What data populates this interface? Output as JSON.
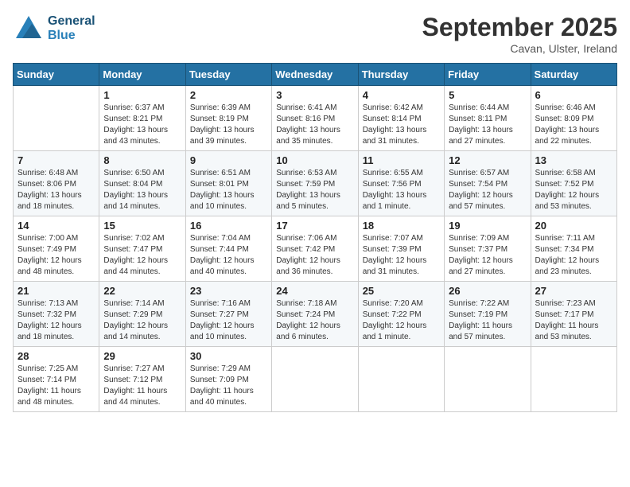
{
  "logo": {
    "general": "General",
    "blue": "Blue"
  },
  "title": "September 2025",
  "subtitle": "Cavan, Ulster, Ireland",
  "days_of_week": [
    "Sunday",
    "Monday",
    "Tuesday",
    "Wednesday",
    "Thursday",
    "Friday",
    "Saturday"
  ],
  "weeks": [
    [
      {
        "day": "",
        "info": ""
      },
      {
        "day": "1",
        "info": "Sunrise: 6:37 AM\nSunset: 8:21 PM\nDaylight: 13 hours\nand 43 minutes."
      },
      {
        "day": "2",
        "info": "Sunrise: 6:39 AM\nSunset: 8:19 PM\nDaylight: 13 hours\nand 39 minutes."
      },
      {
        "day": "3",
        "info": "Sunrise: 6:41 AM\nSunset: 8:16 PM\nDaylight: 13 hours\nand 35 minutes."
      },
      {
        "day": "4",
        "info": "Sunrise: 6:42 AM\nSunset: 8:14 PM\nDaylight: 13 hours\nand 31 minutes."
      },
      {
        "day": "5",
        "info": "Sunrise: 6:44 AM\nSunset: 8:11 PM\nDaylight: 13 hours\nand 27 minutes."
      },
      {
        "day": "6",
        "info": "Sunrise: 6:46 AM\nSunset: 8:09 PM\nDaylight: 13 hours\nand 22 minutes."
      }
    ],
    [
      {
        "day": "7",
        "info": "Sunrise: 6:48 AM\nSunset: 8:06 PM\nDaylight: 13 hours\nand 18 minutes."
      },
      {
        "day": "8",
        "info": "Sunrise: 6:50 AM\nSunset: 8:04 PM\nDaylight: 13 hours\nand 14 minutes."
      },
      {
        "day": "9",
        "info": "Sunrise: 6:51 AM\nSunset: 8:01 PM\nDaylight: 13 hours\nand 10 minutes."
      },
      {
        "day": "10",
        "info": "Sunrise: 6:53 AM\nSunset: 7:59 PM\nDaylight: 13 hours\nand 5 minutes."
      },
      {
        "day": "11",
        "info": "Sunrise: 6:55 AM\nSunset: 7:56 PM\nDaylight: 13 hours\nand 1 minute."
      },
      {
        "day": "12",
        "info": "Sunrise: 6:57 AM\nSunset: 7:54 PM\nDaylight: 12 hours\nand 57 minutes."
      },
      {
        "day": "13",
        "info": "Sunrise: 6:58 AM\nSunset: 7:52 PM\nDaylight: 12 hours\nand 53 minutes."
      }
    ],
    [
      {
        "day": "14",
        "info": "Sunrise: 7:00 AM\nSunset: 7:49 PM\nDaylight: 12 hours\nand 48 minutes."
      },
      {
        "day": "15",
        "info": "Sunrise: 7:02 AM\nSunset: 7:47 PM\nDaylight: 12 hours\nand 44 minutes."
      },
      {
        "day": "16",
        "info": "Sunrise: 7:04 AM\nSunset: 7:44 PM\nDaylight: 12 hours\nand 40 minutes."
      },
      {
        "day": "17",
        "info": "Sunrise: 7:06 AM\nSunset: 7:42 PM\nDaylight: 12 hours\nand 36 minutes."
      },
      {
        "day": "18",
        "info": "Sunrise: 7:07 AM\nSunset: 7:39 PM\nDaylight: 12 hours\nand 31 minutes."
      },
      {
        "day": "19",
        "info": "Sunrise: 7:09 AM\nSunset: 7:37 PM\nDaylight: 12 hours\nand 27 minutes."
      },
      {
        "day": "20",
        "info": "Sunrise: 7:11 AM\nSunset: 7:34 PM\nDaylight: 12 hours\nand 23 minutes."
      }
    ],
    [
      {
        "day": "21",
        "info": "Sunrise: 7:13 AM\nSunset: 7:32 PM\nDaylight: 12 hours\nand 18 minutes."
      },
      {
        "day": "22",
        "info": "Sunrise: 7:14 AM\nSunset: 7:29 PM\nDaylight: 12 hours\nand 14 minutes."
      },
      {
        "day": "23",
        "info": "Sunrise: 7:16 AM\nSunset: 7:27 PM\nDaylight: 12 hours\nand 10 minutes."
      },
      {
        "day": "24",
        "info": "Sunrise: 7:18 AM\nSunset: 7:24 PM\nDaylight: 12 hours\nand 6 minutes."
      },
      {
        "day": "25",
        "info": "Sunrise: 7:20 AM\nSunset: 7:22 PM\nDaylight: 12 hours\nand 1 minute."
      },
      {
        "day": "26",
        "info": "Sunrise: 7:22 AM\nSunset: 7:19 PM\nDaylight: 11 hours\nand 57 minutes."
      },
      {
        "day": "27",
        "info": "Sunrise: 7:23 AM\nSunset: 7:17 PM\nDaylight: 11 hours\nand 53 minutes."
      }
    ],
    [
      {
        "day": "28",
        "info": "Sunrise: 7:25 AM\nSunset: 7:14 PM\nDaylight: 11 hours\nand 48 minutes."
      },
      {
        "day": "29",
        "info": "Sunrise: 7:27 AM\nSunset: 7:12 PM\nDaylight: 11 hours\nand 44 minutes."
      },
      {
        "day": "30",
        "info": "Sunrise: 7:29 AM\nSunset: 7:09 PM\nDaylight: 11 hours\nand 40 minutes."
      },
      {
        "day": "",
        "info": ""
      },
      {
        "day": "",
        "info": ""
      },
      {
        "day": "",
        "info": ""
      },
      {
        "day": "",
        "info": ""
      }
    ]
  ]
}
